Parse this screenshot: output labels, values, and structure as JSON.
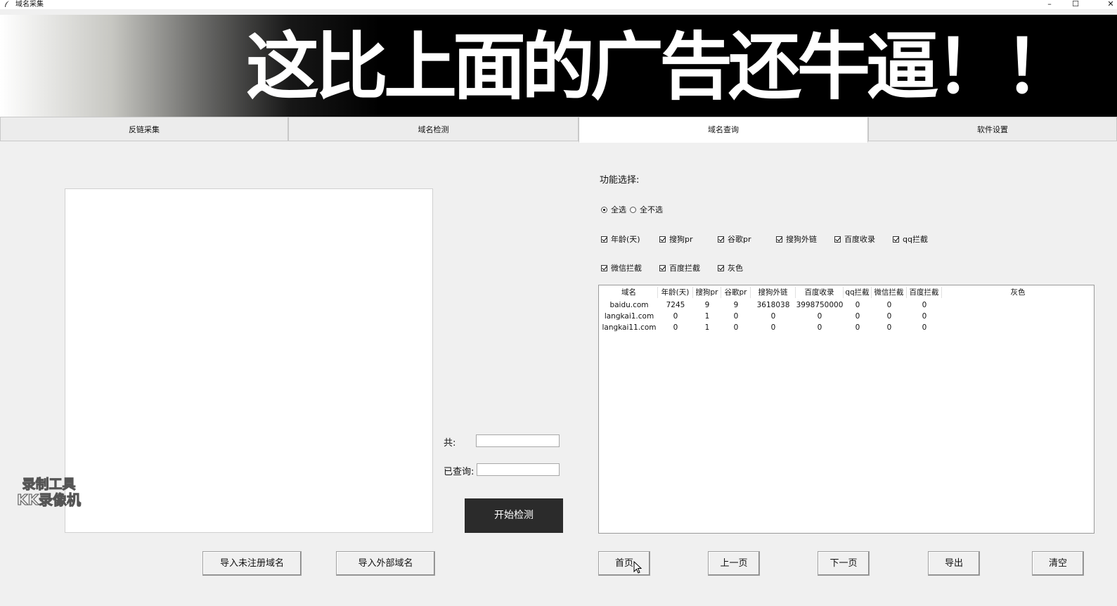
{
  "window": {
    "title": "域名采集",
    "controls": {
      "minimize": "–",
      "maximize": "☐",
      "close": "✕"
    }
  },
  "banner": {
    "text": "这比上面的广告还牛逼！！"
  },
  "tabs": [
    {
      "label": "反链采集",
      "active": false
    },
    {
      "label": "域名检测",
      "active": false
    },
    {
      "label": "域名查询",
      "active": true
    },
    {
      "label": "软件设置",
      "active": false
    }
  ],
  "left": {
    "total_label": "共:",
    "total_value": "",
    "queried_label": "已查询:",
    "queried_value": "",
    "start_button": "开始检测",
    "import_unregistered": "导入未注册域名",
    "import_external": "导入外部域名"
  },
  "right": {
    "function_label": "功能选择:",
    "radios": [
      {
        "label": "全选",
        "selected": true
      },
      {
        "label": "全不选",
        "selected": false
      }
    ],
    "checkboxes_row1": [
      {
        "label": "年龄(天)",
        "checked": true
      },
      {
        "label": "搜狗pr",
        "checked": true
      },
      {
        "label": "谷歌pr",
        "checked": true
      },
      {
        "label": "搜狗外链",
        "checked": true
      },
      {
        "label": "百度收录",
        "checked": true
      },
      {
        "label": "qq拦截",
        "checked": true
      }
    ],
    "checkboxes_row2": [
      {
        "label": "微信拦截",
        "checked": true
      },
      {
        "label": "百度拦截",
        "checked": true
      },
      {
        "label": "灰色",
        "checked": true
      }
    ],
    "table": {
      "columns": [
        "域名",
        "年龄(天)",
        "搜狗pr",
        "谷歌pr",
        "搜狗外链",
        "百度收录",
        "qq拦截",
        "微信拦截",
        "百度拦截",
        "灰色"
      ],
      "rows": [
        [
          "baidu.com",
          "7245",
          "9",
          "9",
          "3618038",
          "3998750000",
          "0",
          "0",
          "0",
          ""
        ],
        [
          "langkai1.com",
          "0",
          "1",
          "0",
          "0",
          "0",
          "0",
          "0",
          "0",
          ""
        ],
        [
          "langkai11.com",
          "0",
          "1",
          "0",
          "0",
          "0",
          "0",
          "0",
          "0",
          ""
        ]
      ]
    },
    "pager": {
      "first": "首页",
      "prev": "上一页",
      "next": "下一页",
      "export": "导出",
      "clear": "清空"
    }
  },
  "watermark": {
    "line1": "录制工具",
    "line2": "KK录像机"
  }
}
